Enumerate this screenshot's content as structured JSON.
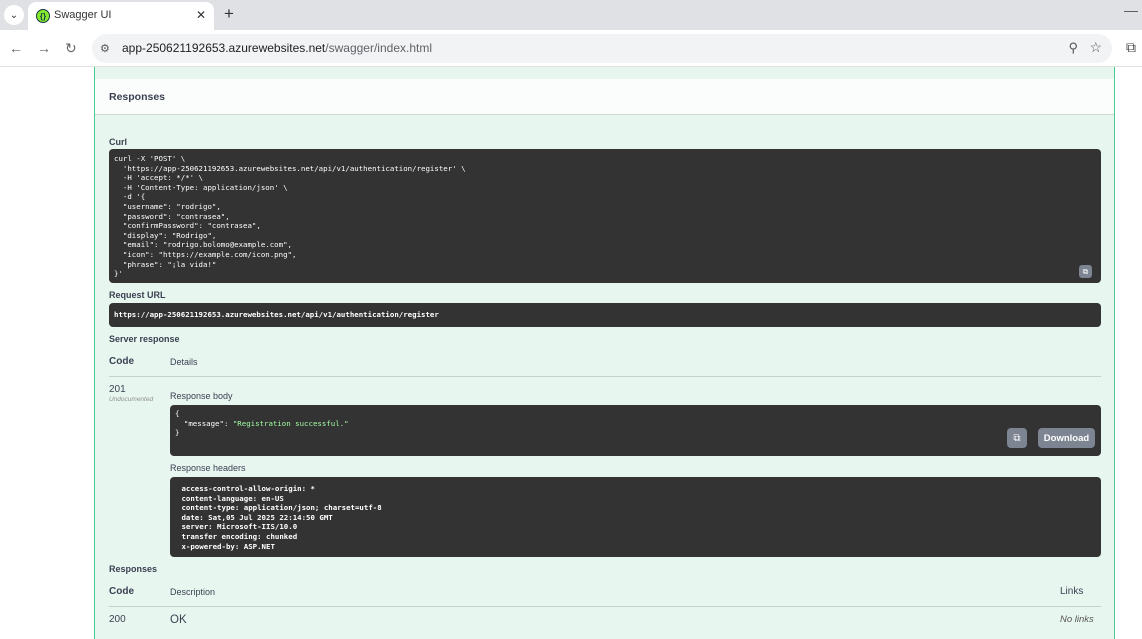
{
  "browser": {
    "tab_title": "Swagger UI",
    "tab_icon": "swagger-favicon",
    "url_host": "app-250621192653.azurewebsites.net",
    "url_path": "/swagger/index.html"
  },
  "responses_section": {
    "title": "Responses",
    "curl_label": "Curl",
    "curl_lines": [
      "curl -X 'POST' \\",
      "  'https://app-250621192653.azurewebsites.net/api/v1/authentication/register' \\",
      "  -H 'accept: */*' \\",
      "  -H 'Content-Type: application/json' \\",
      "  -d '{",
      "  \"username\": \"rodrigo\",",
      "  \"password\": \"contrasea\",",
      "  \"confirmPassword\": \"contrasea\",",
      "  \"display\": \"Rodrigo\",",
      "  \"email\": \"rodrigo.bolomo@example.com\",",
      "  \"icon\": \"https://example.com/icon.png\",",
      "  \"phrase\": \"¡la vida!\"",
      "}'"
    ],
    "request_url_label": "Request URL",
    "request_url": "https://app-250621192653.azurewebsites.net/api/v1/authentication/register",
    "server_response_label": "Server response",
    "col_code": "Code",
    "col_details": "Details",
    "response_code": "201",
    "response_code_note": "Undocumented",
    "response_body_label": "Response body",
    "response_body_lines": [
      "{",
      "  \"message\": \"Registration successful.\"",
      "}"
    ],
    "download_label": "Download",
    "response_headers_label": "Response headers",
    "response_headers_lines": [
      " access-control-allow-origin: * ",
      " content-language: en-US ",
      " content-type: application/json; charset=utf-8 ",
      " date: Sat,05 Jul 2025 22:14:50 GMT ",
      " server: Microsoft-IIS/10.0 ",
      " transfer encoding: chunked ",
      " x-powered-by: ASP.NET "
    ],
    "responses_label": "Responses",
    "table_col_code": "Code",
    "table_col_description": "Description",
    "table_col_links": "Links",
    "row_code": "200",
    "row_description": "OK",
    "row_links": "No links"
  }
}
